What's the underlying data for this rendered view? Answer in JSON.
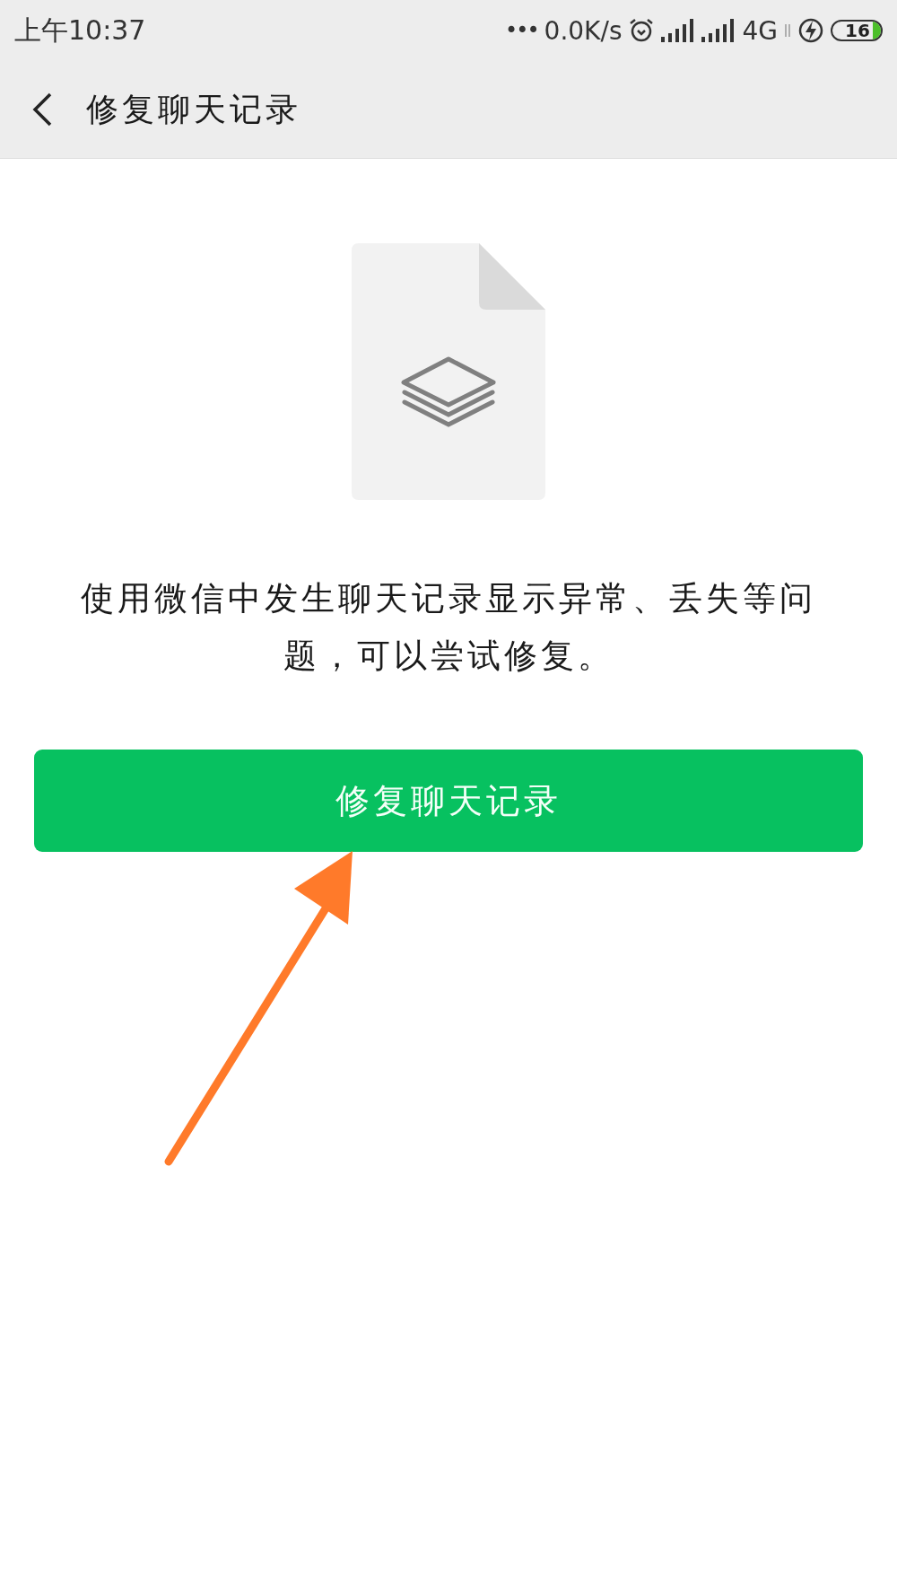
{
  "status_bar": {
    "time": "上午10:37",
    "dots": "•••",
    "speed": "0.0K/s",
    "network": "4G",
    "battery": {
      "text": "16",
      "level": 0.16
    }
  },
  "header": {
    "title": "修复聊天记录"
  },
  "description": "使用微信中发生聊天记录显示异常、丢失等问题，可以尝试修复。",
  "buttons": [
    {
      "label": "修复聊天记录",
      "kind": "primary"
    }
  ]
}
